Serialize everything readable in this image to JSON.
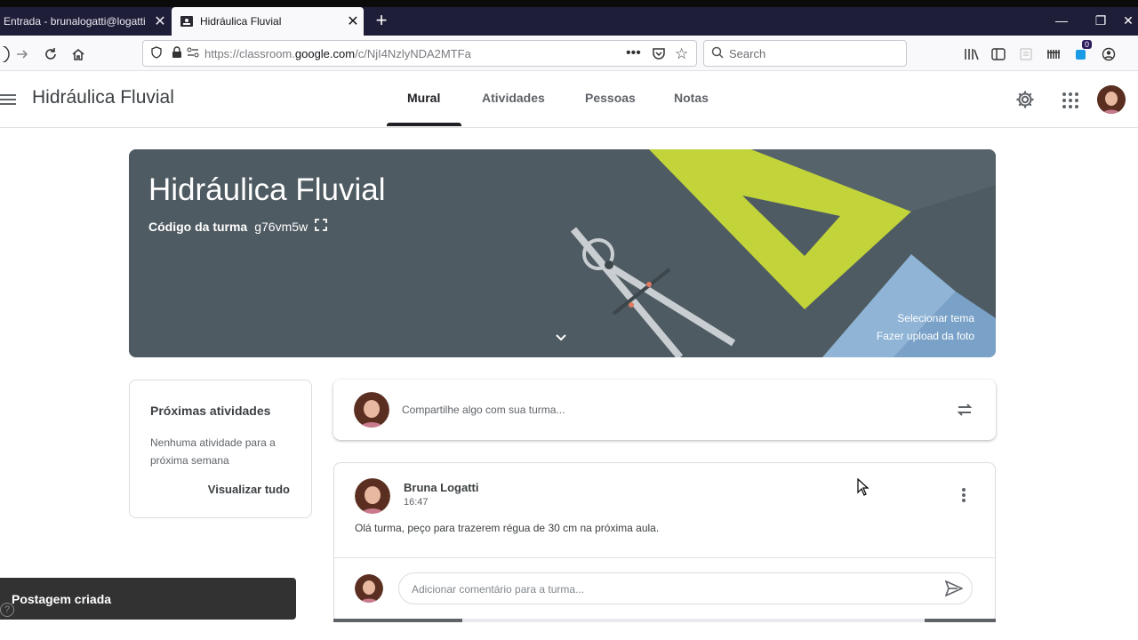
{
  "browser": {
    "tabs": [
      {
        "title": "Entrada - brunalogatti@logatti",
        "active": false
      },
      {
        "title": "Hidráulica Fluvial",
        "active": true
      }
    ],
    "url": {
      "prefix": "https://classroom.",
      "domain": "google.com",
      "path": "/c/NjI4NzlyNDA2MTFa"
    },
    "search_placeholder": "Search",
    "notification_badge": "0"
  },
  "header": {
    "title": "Hidráulica Fluvial",
    "tabs": [
      {
        "label": "Mural",
        "selected": true
      },
      {
        "label": "Atividades",
        "selected": false
      },
      {
        "label": "Pessoas",
        "selected": false
      },
      {
        "label": "Notas",
        "selected": false
      }
    ]
  },
  "banner": {
    "title": "Hidráulica Fluvial",
    "code_label": "Código da turma",
    "code": "g76vm5w",
    "select_theme": "Selecionar tema",
    "upload_photo": "Fazer upload da foto",
    "color": "#4f5b62"
  },
  "upcoming": {
    "heading": "Próximas atividades",
    "empty_text": "Nenhuma atividade para a próxima semana",
    "view_all": "Visualizar tudo"
  },
  "share": {
    "placeholder": "Compartilhe algo com sua turma..."
  },
  "post": {
    "author": "Bruna Logatti",
    "time": "16:47",
    "body": "Olá turma, peço para trazerem régua de 30 cm na próxima aula.",
    "comment_placeholder": "Adicionar comentário para a turma..."
  },
  "toast": {
    "message": "Postagem criada"
  },
  "colors": {
    "tabstrip": "#1f1e38",
    "accent_yellow": "#c6e03a",
    "ruler_blue": "#8fb4d6"
  }
}
